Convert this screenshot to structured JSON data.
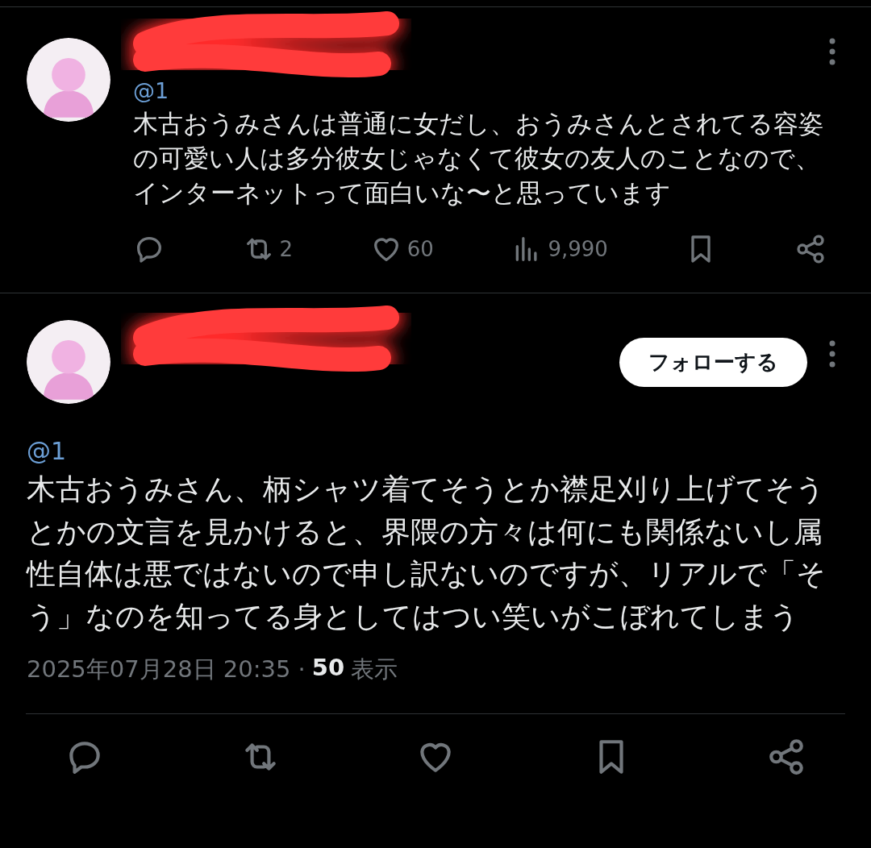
{
  "tweets": [
    {
      "kind": "reply",
      "redacted": true,
      "mention": "@1",
      "text": "木古おうみさんは普通に女だし、おうみさんとされてる容姿の可愛い人は多分彼女じゃなくて彼女の友人のことなので、インターネットって面白いな〜と思っています",
      "actions": [
        {
          "kind": "reply"
        },
        {
          "kind": "repost",
          "count": "2"
        },
        {
          "kind": "like",
          "count": "60"
        },
        {
          "kind": "views",
          "count": "9,990"
        },
        {
          "kind": "bookmark"
        },
        {
          "kind": "share"
        }
      ]
    },
    {
      "kind": "main",
      "redacted": true,
      "follow_button": "フォローする",
      "mention": "@1",
      "text": "木古おうみさん、柄シャツ着てそうとか襟足刈り上げてそうとかの文言を見かけると、界隈の方々は何にも関係ないし属性自体は悪ではないので申し訳ないのですが、リアルで「そう」なのを知ってる身としてはつい笑いがこぼれてしまう",
      "timestamp": "2025年07月28日 20:35 ·",
      "views": "50",
      "views_label": "表示",
      "actions": [
        {
          "kind": "reply"
        },
        {
          "kind": "repost"
        },
        {
          "kind": "like"
        },
        {
          "kind": "bookmark"
        },
        {
          "kind": "share"
        }
      ]
    }
  ]
}
